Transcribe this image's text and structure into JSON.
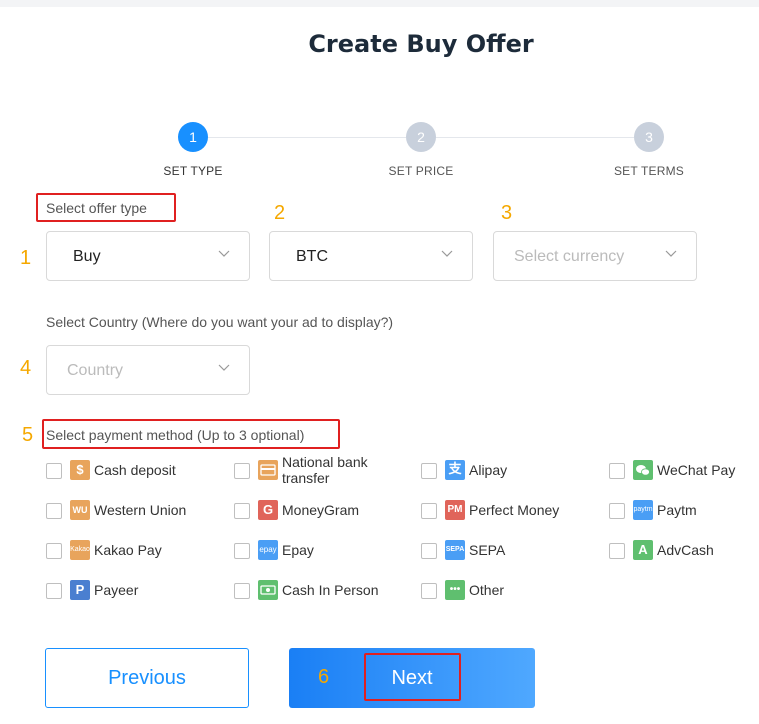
{
  "page": {
    "title": "Create Buy Offer"
  },
  "stepper": {
    "steps": [
      {
        "number": "1",
        "label": "SET TYPE"
      },
      {
        "number": "2",
        "label": "SET PRICE"
      },
      {
        "number": "3",
        "label": "SET TERMS"
      }
    ]
  },
  "annotations": {
    "n1": "1",
    "n2": "2",
    "n3": "3",
    "n4": "4",
    "n5": "5",
    "n6": "6"
  },
  "offer_type": {
    "label": "Select offer type",
    "type_value": "Buy",
    "asset_value": "BTC",
    "currency_placeholder": "Select currency"
  },
  "country": {
    "label": "Select Country  (Where do you want your ad to display?)",
    "placeholder": "Country"
  },
  "payment": {
    "label": "Select payment method  (Up to 3 optional)",
    "methods": [
      {
        "label": "Cash deposit",
        "icon": "$"
      },
      {
        "label": "National bank transfer",
        "icon": "card"
      },
      {
        "label": "Alipay",
        "icon": "支"
      },
      {
        "label": "WeChat Pay",
        "icon": "chat"
      },
      {
        "label": "Western Union",
        "icon": "WU"
      },
      {
        "label": "MoneyGram",
        "icon": "G"
      },
      {
        "label": "Perfect Money",
        "icon": "PM"
      },
      {
        "label": "Paytm",
        "icon": "paytm"
      },
      {
        "label": "Kakao Pay",
        "icon": "Kakao"
      },
      {
        "label": "Epay",
        "icon": "epay"
      },
      {
        "label": "SEPA",
        "icon": "SEPA"
      },
      {
        "label": "AdvCash",
        "icon": "A"
      },
      {
        "label": "Payeer",
        "icon": "P"
      },
      {
        "label": "Cash In Person",
        "icon": "cash"
      },
      {
        "label": "Other",
        "icon": "•••"
      }
    ]
  },
  "buttons": {
    "previous": "Previous",
    "next": "Next"
  },
  "colors": {
    "primary": "#1890ff",
    "highlight": "#e02020",
    "annotation": "#f5a800"
  }
}
